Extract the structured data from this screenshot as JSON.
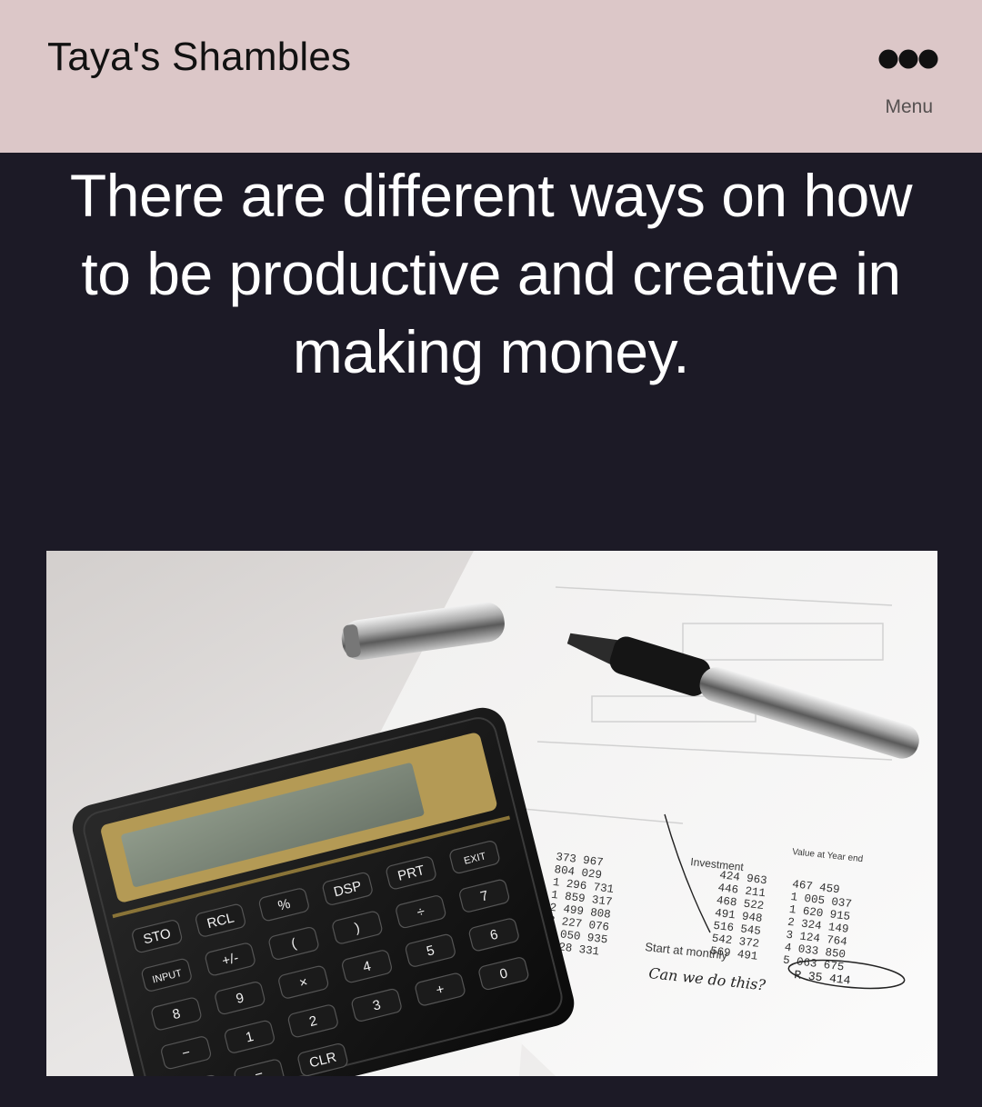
{
  "header": {
    "site_title": "Taya's Shambles",
    "menu_label": "Menu",
    "menu_icon": "more-dots-icon",
    "background_color": "#dcc7c8"
  },
  "main": {
    "background_color": "#1c1a26",
    "headline": "There are different ways on how to be productive and creative in making money."
  },
  "hero_image": {
    "subject": "calculator-pen-and-financial-papers",
    "paper_labels": {
      "investment": "Investment",
      "value_year_end": "Value at Year end",
      "start_note": "Start at monthly",
      "handwritten": "Can we do this?"
    },
    "column_left": [
      "373 967",
      "804 029",
      "1 296 731",
      "1 859 317",
      "2 499 808",
      "3 227 076",
      "4 050 935",
      "R 28 331"
    ],
    "column_mid": [
      "424 963",
      "446 211",
      "468 522",
      "491 948",
      "516 545",
      "542 372",
      "569 491"
    ],
    "column_right": [
      "467 459",
      "1 005 037",
      "1 620 915",
      "2 324 149",
      "3 124 764",
      "4 033 850",
      "5 063 675"
    ],
    "circled_value": "R 35 414",
    "calculator_keys": [
      "STO",
      "RCL",
      "%",
      "DSP",
      "PRT",
      "EXIT",
      "INPUT",
      "+/-",
      "(",
      ")",
      "÷",
      "7",
      "8",
      "9",
      "×",
      "4",
      "5",
      "6",
      "−",
      "1",
      "2",
      "3",
      "+",
      "0",
      ".",
      "=",
      "CLR"
    ]
  }
}
